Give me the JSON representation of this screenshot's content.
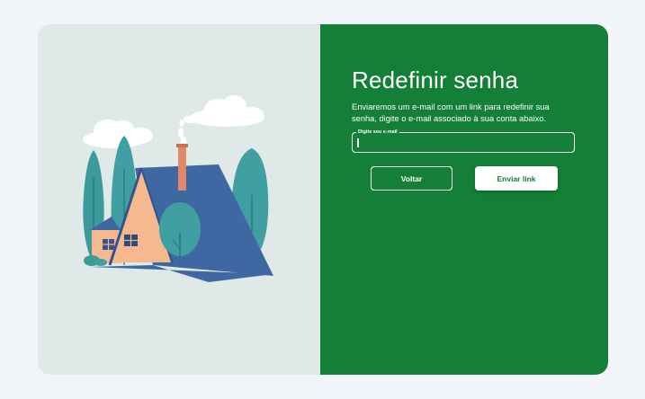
{
  "form": {
    "title": "Redefinir senha",
    "description": "Enviaremos um e-mail com um link para redefinir sua senha, digite o e-mail associado à sua conta abaixo.",
    "email_label": "Digite seu e-mail",
    "email_value": "",
    "back_label": "Voltar",
    "send_label": "Enviar link"
  },
  "illustration": {
    "icon": "house-illustration"
  },
  "colors": {
    "page_background": "#f1f4f9",
    "panel_left": "#dfe9e7",
    "panel_right": "#137f37",
    "roof": "#3f68a3",
    "wall": "#f6b88e",
    "tree": "#3b9b9a"
  }
}
